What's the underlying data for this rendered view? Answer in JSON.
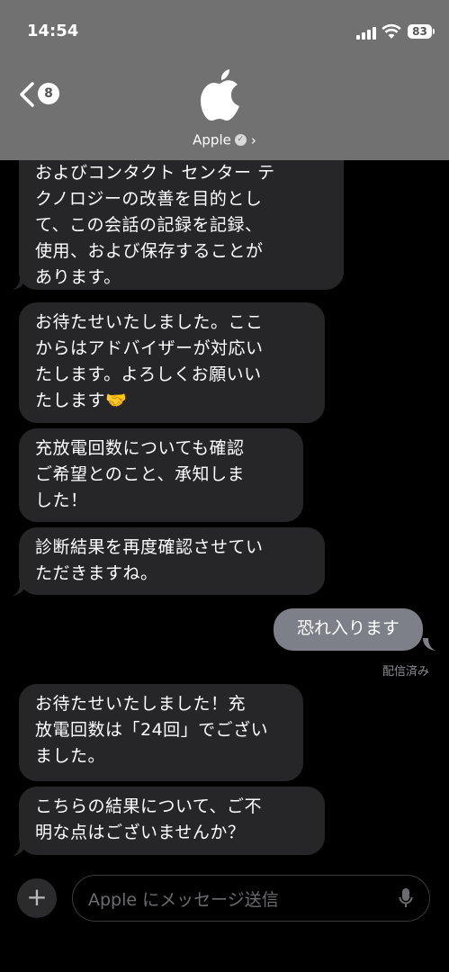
{
  "status_bar": {
    "time": "14:54",
    "battery": "83"
  },
  "nav": {
    "back_badge": "8",
    "contact_name": "Apple"
  },
  "messages": [
    {
      "direction": "incoming",
      "text": "およびコンタクト センター テ\nクノロジーの改善を目的とし\nて、この会話の記録を記録、\n使用、および保存することが\nあります。"
    },
    {
      "direction": "incoming",
      "text": "お待たせいたしました。ここ\nからはアドバイザーが対応い\nたします。よろしくお願いい\nたします🤝"
    },
    {
      "direction": "incoming",
      "text": "充放電回数についても確認\nご希望とのこと、承知しま\nした！"
    },
    {
      "direction": "incoming",
      "text": "診断結果を再度確認させてい\nただきますね。"
    },
    {
      "direction": "outgoing",
      "text": "恐れ入ります"
    },
    {
      "direction": "incoming",
      "text": "お待たせいたしました！充\n放電回数は「24回」でござい\nました。"
    },
    {
      "direction": "incoming",
      "text": "こちらの結果について、ご不\n明な点はございませんか？"
    }
  ],
  "delivered_label": "配信済み",
  "composer": {
    "placeholder": "Apple にメッセージ送信",
    "add_label": "+"
  }
}
